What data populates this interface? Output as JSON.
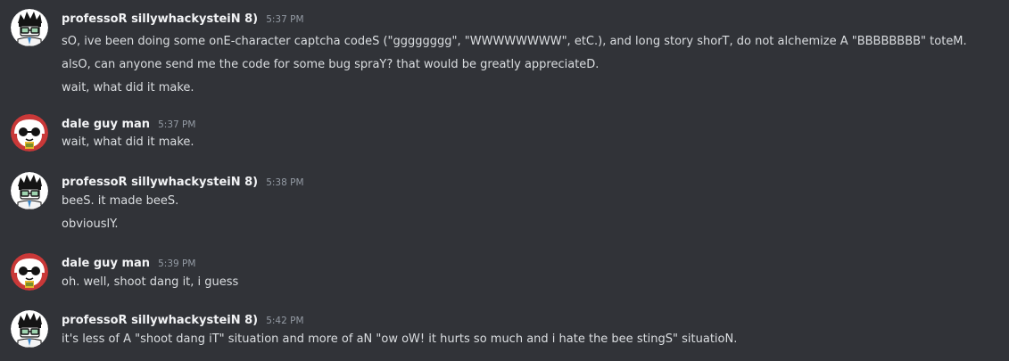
{
  "messages": [
    {
      "username": "professoR sillywhackysteiN 8)",
      "time": "5:37 PM",
      "lines": [
        "sO, ive been doing some onE-character captcha codeS (\"gggggggg\", \"WWWWWWWW\", etC.), and long story shorT, do not alchemize A \"BBBBBBBB\" toteM.",
        "alsO, can anyone send me the code for some bug spraY? that would be greatly appreciateD.",
        "wait, what did it make."
      ]
    },
    {
      "username": "dale guy man",
      "time": "5:37 PM",
      "lines": [
        "wait, what did it make."
      ]
    },
    {
      "username": "professoR sillywhackysteiN 8)",
      "time": "5:38 PM",
      "lines": [
        "beeS. it made beeS.",
        "obviouslY."
      ]
    },
    {
      "username": "dale guy man",
      "time": "5:39 PM",
      "lines": [
        "oh. well, shoot dang it, i guess"
      ]
    },
    {
      "username": "professoR sillywhackysteiN 8)",
      "time": "5:42 PM",
      "lines": [
        "it's less of A \"shoot dang iT\" situation and more of aN \"ow oW! it hurts so much and i hate the bee stingS\" situatioN."
      ]
    }
  ],
  "colors": {
    "background": "#313338",
    "username": "#f2f3f5",
    "timestamp": "#949ba4",
    "text": "#dbdee1"
  },
  "icons": {
    "professor_avatar": "professor-avatar-icon",
    "dale_avatar": "dale-avatar-icon"
  }
}
